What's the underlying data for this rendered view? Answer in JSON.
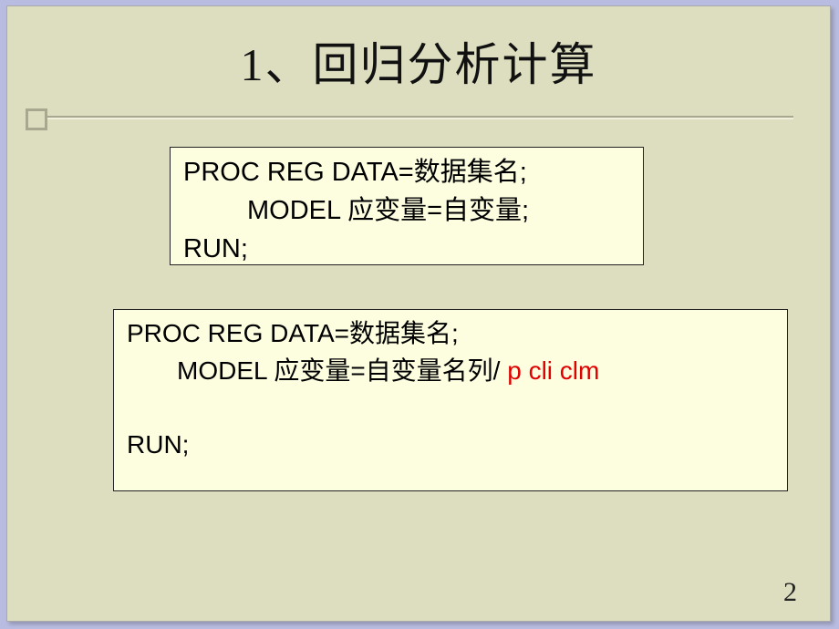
{
  "title": "1、回归分析计算",
  "code1": {
    "line1": "PROC REG DATA=数据集名;",
    "line2_indent": "MODEL 应变量=自变量;",
    "line3": "RUN;"
  },
  "code2": {
    "line1": "PROC REG DATA=数据集名;",
    "line2_indent_pre": "MODEL 应变量=自变量名列/ ",
    "line2_red": "p cli clm",
    "line3_blank": " ",
    "line4": "RUN;"
  },
  "page_number": "2"
}
